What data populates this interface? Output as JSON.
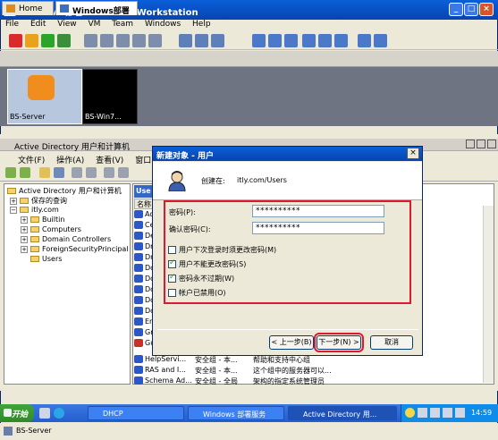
{
  "window": {
    "title": "Windows部署 - VMware Workstation"
  },
  "vm_menu": [
    "File",
    "Edit",
    "View",
    "VM",
    "Team",
    "Windows",
    "Help"
  ],
  "vm_tabs": [
    {
      "label": "Home"
    },
    {
      "label": "Windows部署"
    }
  ],
  "thumbnails": [
    {
      "label": "BS-Server"
    },
    {
      "label": "BS-Win7..."
    }
  ],
  "ad": {
    "title": "Active Directory 用户和计算机",
    "menu": [
      "文件(F)",
      "操作(A)",
      "查看(V)",
      "窗口(W)"
    ],
    "tree": [
      {
        "label": "Active Directory 用户和计算机"
      },
      {
        "label": "保存的查询"
      },
      {
        "label": "itly.com"
      },
      {
        "label": "Builtin"
      },
      {
        "label": "Computers"
      },
      {
        "label": "Domain Controllers"
      },
      {
        "label": "ForeignSecurityPrincipal"
      },
      {
        "label": "Users"
      }
    ],
    "list_header": "Use",
    "column_name": "名称",
    "rows": [
      {
        "name": "Ad",
        "type": "",
        "desc": ""
      },
      {
        "name": "Ce",
        "type": "",
        "desc": ""
      },
      {
        "name": "De",
        "type": "",
        "desc": ""
      },
      {
        "name": "Dn",
        "type": "",
        "desc": ""
      },
      {
        "name": "Dn",
        "type": "",
        "desc": ""
      },
      {
        "name": "Do",
        "type": "",
        "desc": ""
      },
      {
        "name": "Do",
        "type": "",
        "desc": ""
      },
      {
        "name": "Do",
        "type": "",
        "desc": ""
      },
      {
        "name": "Do",
        "type": "",
        "desc": ""
      },
      {
        "name": "Do",
        "type": "",
        "desc": ""
      },
      {
        "name": "En",
        "type": "",
        "desc": ""
      },
      {
        "name": "Gr",
        "type": "",
        "desc": ""
      },
      {
        "name": "Gu",
        "type": "",
        "desc": ""
      },
      {
        "name": "HelpServi...",
        "type": "安全组 - 本...",
        "desc": "帮助和支持中心组"
      },
      {
        "name": "RAS and I...",
        "type": "安全组 - 本...",
        "desc": "这个组中的服务器可以..."
      },
      {
        "name": "Schema Ad...",
        "type": "安全组 - 全局",
        "desc": "架构的指定系统管理员"
      }
    ]
  },
  "dialog": {
    "title": "新建对象 - 用户",
    "create_in_label": "创建在:",
    "create_in_value": "itly.com/Users",
    "password_label": "密码(P):",
    "password_value": "**********",
    "confirm_label": "确认密码(C):",
    "confirm_value": "**********",
    "options": [
      {
        "label": "用户下次登录时须更改密码(M)",
        "checked": false
      },
      {
        "label": "用户不能更改密码(S)",
        "checked": true
      },
      {
        "label": "密码永不过期(W)",
        "checked": true
      },
      {
        "label": "帐户已禁用(O)",
        "checked": false
      }
    ],
    "back_button": "< 上一步(B)",
    "next_button": "下一步(N) >",
    "cancel_button": "取消"
  },
  "taskbar": {
    "start": "开始",
    "buttons": [
      "DHCP",
      "Windows 部署服务",
      "Active Directory 用..."
    ],
    "clock": "14:59"
  },
  "status_bar": {
    "text": "BS-Server"
  },
  "colors": {
    "highlight": "#e0182e",
    "titlebar": "#0a5fd8"
  }
}
